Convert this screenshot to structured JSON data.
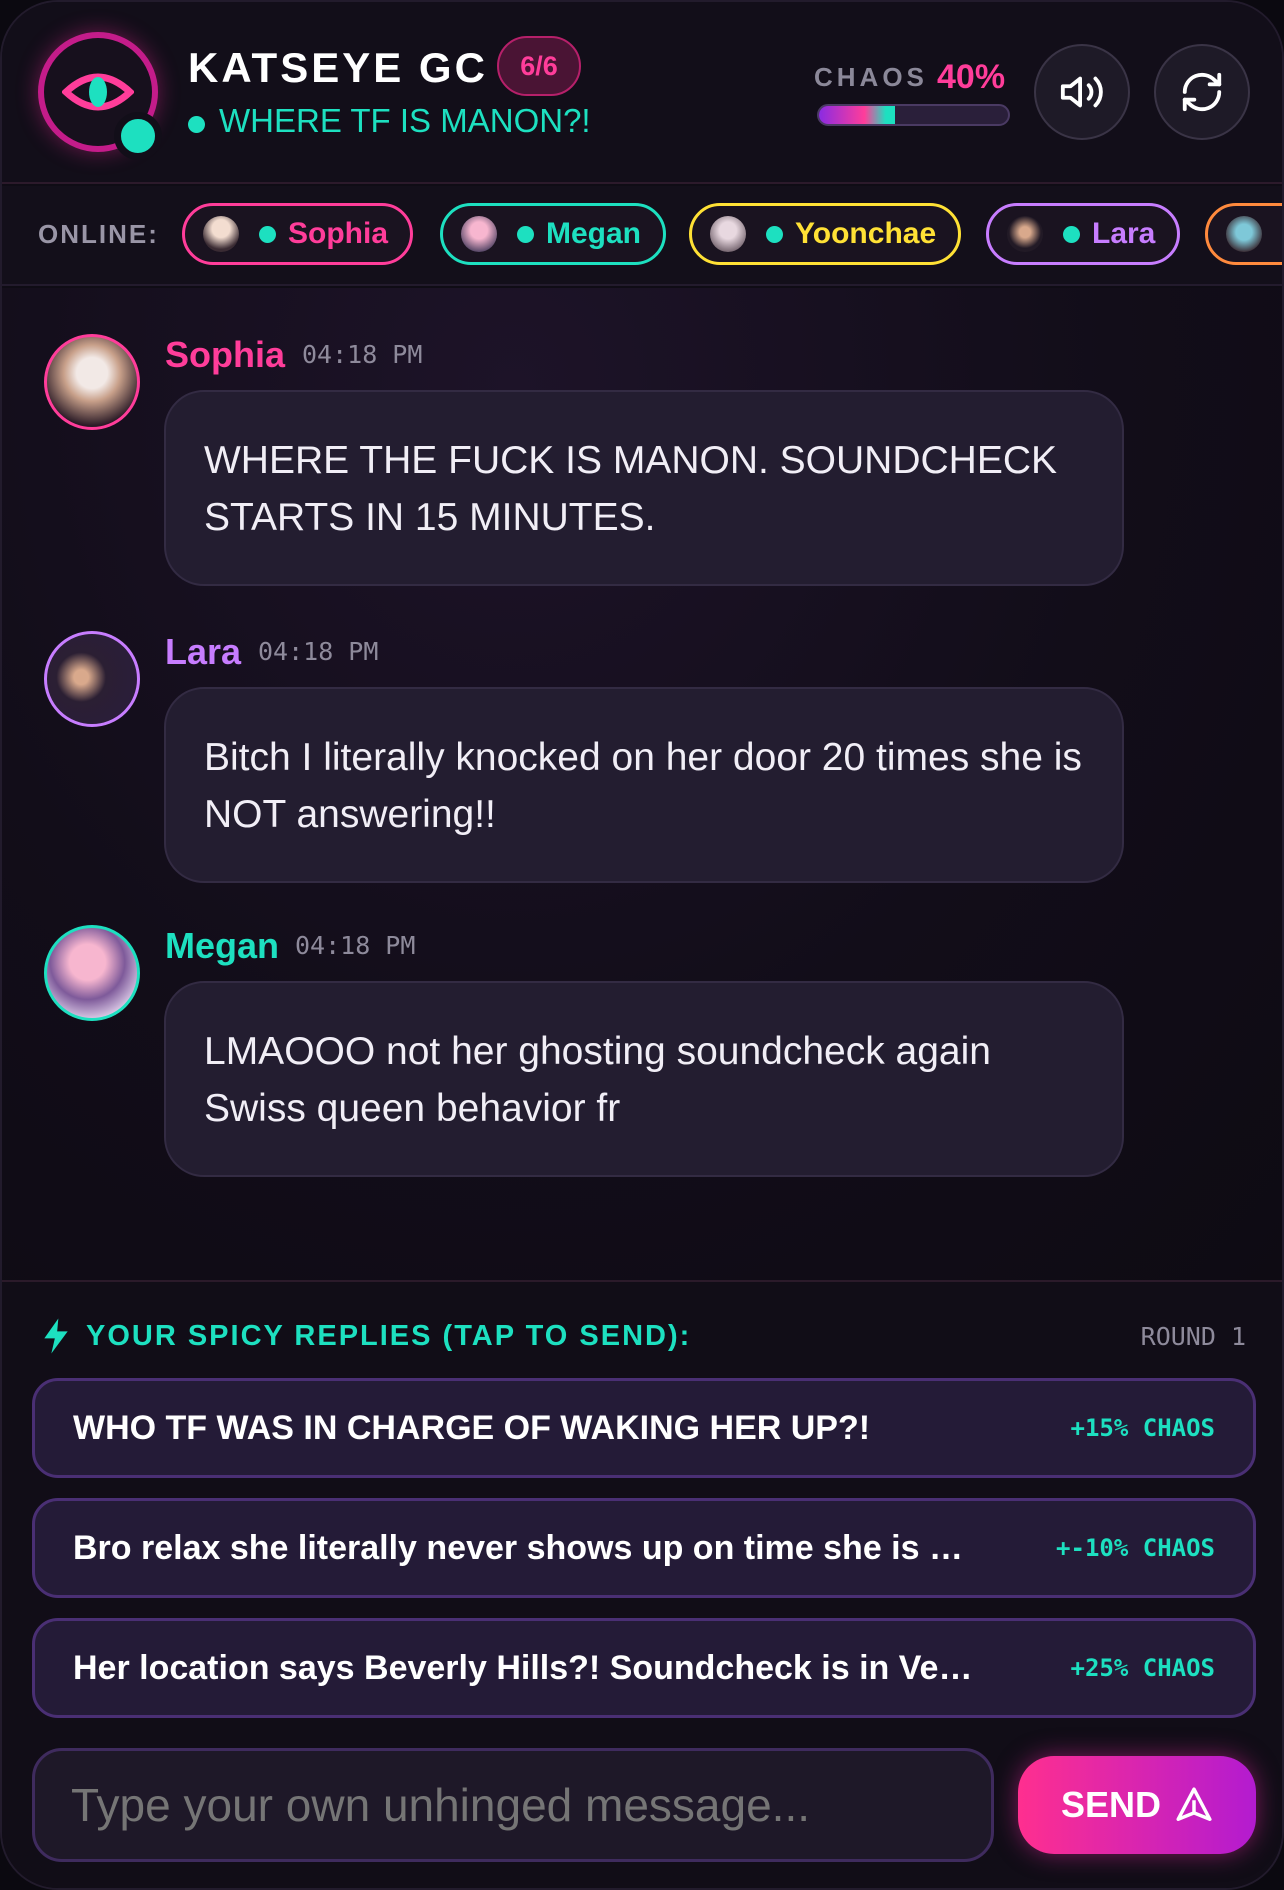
{
  "header": {
    "title": "KATSEYE GC",
    "member_badge": "6/6",
    "status": "WHERE TF IS MANON?!",
    "chaos_label": "CHAOS",
    "chaos_value": "40%",
    "chaos_level": 0.4,
    "sound_icon": "speaker-icon",
    "refresh_icon": "refresh-icon",
    "logo_icon": "eye-icon"
  },
  "online": {
    "label": "ONLINE:",
    "members": [
      {
        "name": "Sophia",
        "color": "#ff3d9a"
      },
      {
        "name": "Megan",
        "color": "#1de0c0"
      },
      {
        "name": "Yoonchae",
        "color": "#ffe135"
      },
      {
        "name": "Lara",
        "color": "#c77dff"
      },
      {
        "name": "",
        "color": "#ff8a3d"
      }
    ]
  },
  "messages": [
    {
      "sender": "Sophia",
      "time": "04:18 PM",
      "text": "WHERE THE FUCK IS MANON. SOUNDCHECK STARTS IN 15 MINUTES.",
      "color": "#ff3d9a"
    },
    {
      "sender": "Lara",
      "time": "04:18 PM",
      "text": "Bitch I literally knocked on her door 20 times she is NOT answering!!",
      "color": "#c77dff"
    },
    {
      "sender": "Megan",
      "time": "04:18 PM",
      "text": "LMAOOO not her ghosting soundcheck again Swiss queen behavior fr",
      "color": "#1de0c0"
    }
  ],
  "replies": {
    "header": "YOUR SPICY REPLIES (TAP TO SEND):",
    "round": "ROUND 1",
    "options": [
      {
        "text": "WHO TF WAS IN CHARGE OF WAKING HER UP?!",
        "chaos": "+15% CHAOS"
      },
      {
        "text": "Bro relax she literally never shows up on time she is …",
        "chaos": "+-10% CHAOS"
      },
      {
        "text": "Her location says Beverly Hills?! Soundcheck is in Ve…",
        "chaos": "+25% CHAOS"
      }
    ]
  },
  "composer": {
    "placeholder": "Type your own unhinged message...",
    "send_label": "SEND",
    "send_icon": "send-icon"
  },
  "colors": {
    "accent_pink": "#ff3d9a",
    "accent_teal": "#1de0c0",
    "accent_purple": "#c77dff",
    "accent_yellow": "#ffe135",
    "accent_orange": "#ff8a3d"
  }
}
